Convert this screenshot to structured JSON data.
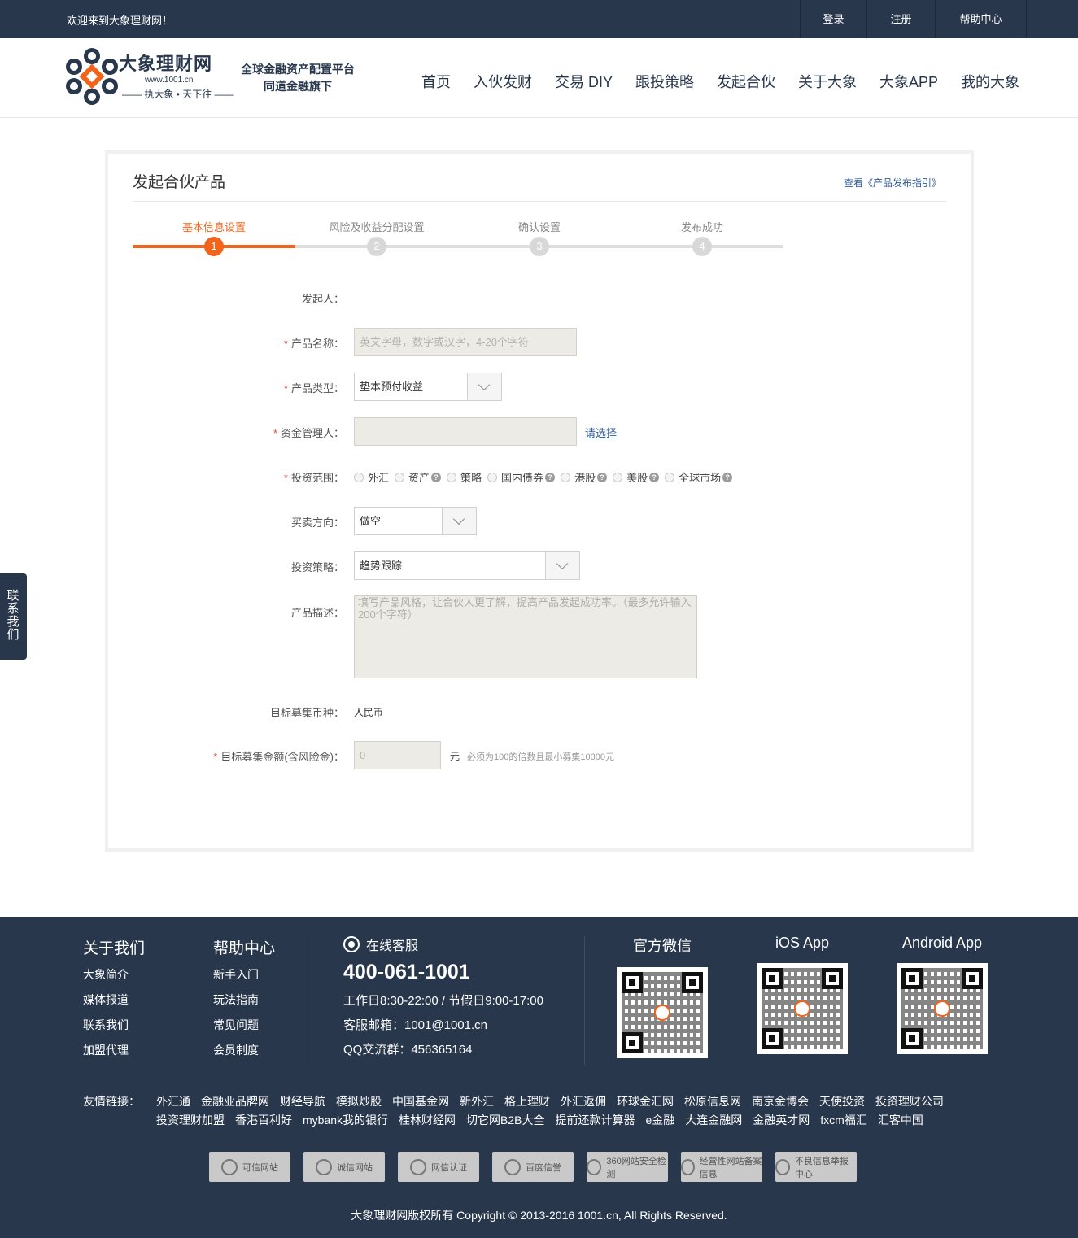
{
  "topbar": {
    "welcome": "欢迎来到大象理财网！",
    "links": [
      "登录",
      "注册",
      "帮助中心"
    ]
  },
  "header": {
    "brand": "大象理财网",
    "url": "www.1001.cn",
    "slogan": "—— 执大象 • 天下往 ——",
    "tagline1": "全球金融资产配置平台",
    "tagline2": "同道金融旗下",
    "nav": [
      "首页",
      "入伙发财",
      "交易 DIY",
      "跟投策略",
      "发起合伙",
      "关于大象",
      "大象APP",
      "我的大象"
    ]
  },
  "card": {
    "title": "发起合伙产品",
    "guide_link": "查看《产品发布指引》"
  },
  "steps": [
    {
      "label": "基本信息设置",
      "num": "1"
    },
    {
      "label": "风险及收益分配设置",
      "num": "2"
    },
    {
      "label": "确认设置",
      "num": "3"
    },
    {
      "label": "发布成功",
      "num": "4"
    }
  ],
  "form": {
    "initiator_label": "发起人：",
    "name_label": "产品名称：",
    "name_placeholder": "英文字母，数字或汉字，4-20个字符",
    "type_label": "产品类型：",
    "type_value": "垫本预付收益",
    "manager_label": "资金管理人：",
    "manager_link": "请选择",
    "scope_label": "投资范围：",
    "scope_options": [
      "外汇",
      "资产",
      "策略",
      "国内债券",
      "港股",
      "美股",
      "全球市场"
    ],
    "direction_label": "买卖方向：",
    "direction_value": "做空",
    "strategy_label": "投资策略：",
    "strategy_value": "趋势跟踪",
    "desc_label": "产品描述：",
    "desc_placeholder": "填写产品风格，让合伙人更了解，提高产品发起成功率。（最多允许输入200个字符）",
    "currency_label": "目标募集币种：",
    "currency_value": "人民币",
    "amount_label": "目标募集金额(含风险金)：",
    "amount_value": "0",
    "amount_unit": "元",
    "amount_hint": "必须为100的倍数且最小募集10000元",
    "required_mark": "*"
  },
  "sidetab": "联系我们",
  "footer": {
    "about_title": "关于我们",
    "about_links": [
      "大象简介",
      "媒体报道",
      "联系我们",
      "加盟代理"
    ],
    "help_title": "帮助中心",
    "help_links": [
      "新手入门",
      "玩法指南",
      "常见问题",
      "会员制度"
    ],
    "service_title": "在线客服",
    "phone": "400-061-1001",
    "hours": "工作日8:30-22:00 / 节假日9:00-17:00",
    "email": "客服邮箱：1001@1001.cn",
    "qq": "QQ交流群：456365164",
    "qr_titles": [
      "官方微信",
      "iOS App",
      "Android App"
    ],
    "friends_label": "友情链接：",
    "friends": [
      "外汇通",
      "金融业品牌网",
      "财经导航",
      "模拟炒股",
      "中国基金网",
      "新外汇",
      "格上理财",
      "外汇返佣",
      "环球金汇网",
      "松原信息网",
      "南京金博会",
      "天使投资",
      "投资理财公司",
      "投资理财加盟",
      "香港百利好",
      "mybank我的银行",
      "桂林财经网",
      "切它网B2B大全",
      "提前还款计算器",
      "e金融",
      "大连金融网",
      "金融英才网",
      "fxcm福汇",
      "汇客中国"
    ],
    "badges": [
      "可信网站",
      "诚信网站",
      "网信认证",
      "百度信誉",
      "360网站安全检测",
      "经营性网站备案信息",
      "不良信息举报中心"
    ],
    "copyright": "大象理财网版权所有 Copyright © 2013-2016 1001.cn, All Rights Reserved."
  },
  "colors": {
    "navy": "#28374c",
    "accent": "#f2641c",
    "link": "#2f5a96"
  }
}
